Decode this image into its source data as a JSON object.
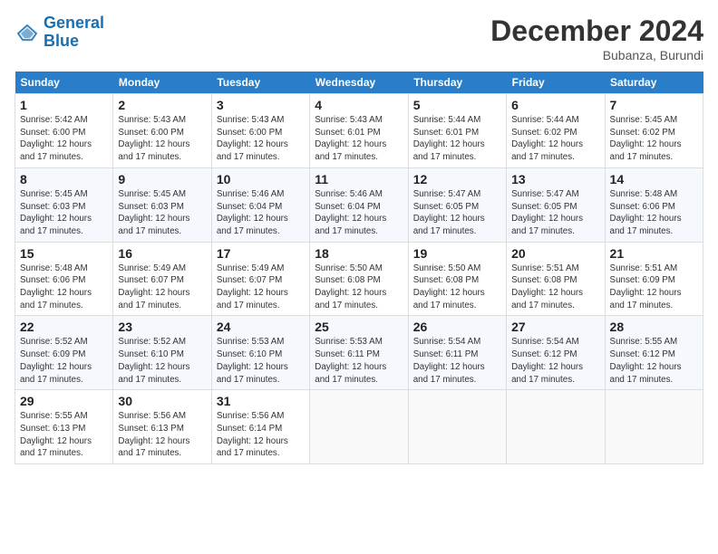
{
  "header": {
    "logo_line1": "General",
    "logo_line2": "Blue",
    "month_title": "December 2024",
    "subtitle": "Bubanza, Burundi"
  },
  "weekdays": [
    "Sunday",
    "Monday",
    "Tuesday",
    "Wednesday",
    "Thursday",
    "Friday",
    "Saturday"
  ],
  "weeks": [
    [
      {
        "day": "1",
        "info": "Sunrise: 5:42 AM\nSunset: 6:00 PM\nDaylight: 12 hours and 17 minutes."
      },
      {
        "day": "2",
        "info": "Sunrise: 5:43 AM\nSunset: 6:00 PM\nDaylight: 12 hours and 17 minutes."
      },
      {
        "day": "3",
        "info": "Sunrise: 5:43 AM\nSunset: 6:00 PM\nDaylight: 12 hours and 17 minutes."
      },
      {
        "day": "4",
        "info": "Sunrise: 5:43 AM\nSunset: 6:01 PM\nDaylight: 12 hours and 17 minutes."
      },
      {
        "day": "5",
        "info": "Sunrise: 5:44 AM\nSunset: 6:01 PM\nDaylight: 12 hours and 17 minutes."
      },
      {
        "day": "6",
        "info": "Sunrise: 5:44 AM\nSunset: 6:02 PM\nDaylight: 12 hours and 17 minutes."
      },
      {
        "day": "7",
        "info": "Sunrise: 5:45 AM\nSunset: 6:02 PM\nDaylight: 12 hours and 17 minutes."
      }
    ],
    [
      {
        "day": "8",
        "info": "Sunrise: 5:45 AM\nSunset: 6:03 PM\nDaylight: 12 hours and 17 minutes."
      },
      {
        "day": "9",
        "info": "Sunrise: 5:45 AM\nSunset: 6:03 PM\nDaylight: 12 hours and 17 minutes."
      },
      {
        "day": "10",
        "info": "Sunrise: 5:46 AM\nSunset: 6:04 PM\nDaylight: 12 hours and 17 minutes."
      },
      {
        "day": "11",
        "info": "Sunrise: 5:46 AM\nSunset: 6:04 PM\nDaylight: 12 hours and 17 minutes."
      },
      {
        "day": "12",
        "info": "Sunrise: 5:47 AM\nSunset: 6:05 PM\nDaylight: 12 hours and 17 minutes."
      },
      {
        "day": "13",
        "info": "Sunrise: 5:47 AM\nSunset: 6:05 PM\nDaylight: 12 hours and 17 minutes."
      },
      {
        "day": "14",
        "info": "Sunrise: 5:48 AM\nSunset: 6:06 PM\nDaylight: 12 hours and 17 minutes."
      }
    ],
    [
      {
        "day": "15",
        "info": "Sunrise: 5:48 AM\nSunset: 6:06 PM\nDaylight: 12 hours and 17 minutes."
      },
      {
        "day": "16",
        "info": "Sunrise: 5:49 AM\nSunset: 6:07 PM\nDaylight: 12 hours and 17 minutes."
      },
      {
        "day": "17",
        "info": "Sunrise: 5:49 AM\nSunset: 6:07 PM\nDaylight: 12 hours and 17 minutes."
      },
      {
        "day": "18",
        "info": "Sunrise: 5:50 AM\nSunset: 6:08 PM\nDaylight: 12 hours and 17 minutes."
      },
      {
        "day": "19",
        "info": "Sunrise: 5:50 AM\nSunset: 6:08 PM\nDaylight: 12 hours and 17 minutes."
      },
      {
        "day": "20",
        "info": "Sunrise: 5:51 AM\nSunset: 6:08 PM\nDaylight: 12 hours and 17 minutes."
      },
      {
        "day": "21",
        "info": "Sunrise: 5:51 AM\nSunset: 6:09 PM\nDaylight: 12 hours and 17 minutes."
      }
    ],
    [
      {
        "day": "22",
        "info": "Sunrise: 5:52 AM\nSunset: 6:09 PM\nDaylight: 12 hours and 17 minutes."
      },
      {
        "day": "23",
        "info": "Sunrise: 5:52 AM\nSunset: 6:10 PM\nDaylight: 12 hours and 17 minutes."
      },
      {
        "day": "24",
        "info": "Sunrise: 5:53 AM\nSunset: 6:10 PM\nDaylight: 12 hours and 17 minutes."
      },
      {
        "day": "25",
        "info": "Sunrise: 5:53 AM\nSunset: 6:11 PM\nDaylight: 12 hours and 17 minutes."
      },
      {
        "day": "26",
        "info": "Sunrise: 5:54 AM\nSunset: 6:11 PM\nDaylight: 12 hours and 17 minutes."
      },
      {
        "day": "27",
        "info": "Sunrise: 5:54 AM\nSunset: 6:12 PM\nDaylight: 12 hours and 17 minutes."
      },
      {
        "day": "28",
        "info": "Sunrise: 5:55 AM\nSunset: 6:12 PM\nDaylight: 12 hours and 17 minutes."
      }
    ],
    [
      {
        "day": "29",
        "info": "Sunrise: 5:55 AM\nSunset: 6:13 PM\nDaylight: 12 hours and 17 minutes."
      },
      {
        "day": "30",
        "info": "Sunrise: 5:56 AM\nSunset: 6:13 PM\nDaylight: 12 hours and 17 minutes."
      },
      {
        "day": "31",
        "info": "Sunrise: 5:56 AM\nSunset: 6:14 PM\nDaylight: 12 hours and 17 minutes."
      },
      null,
      null,
      null,
      null
    ]
  ]
}
